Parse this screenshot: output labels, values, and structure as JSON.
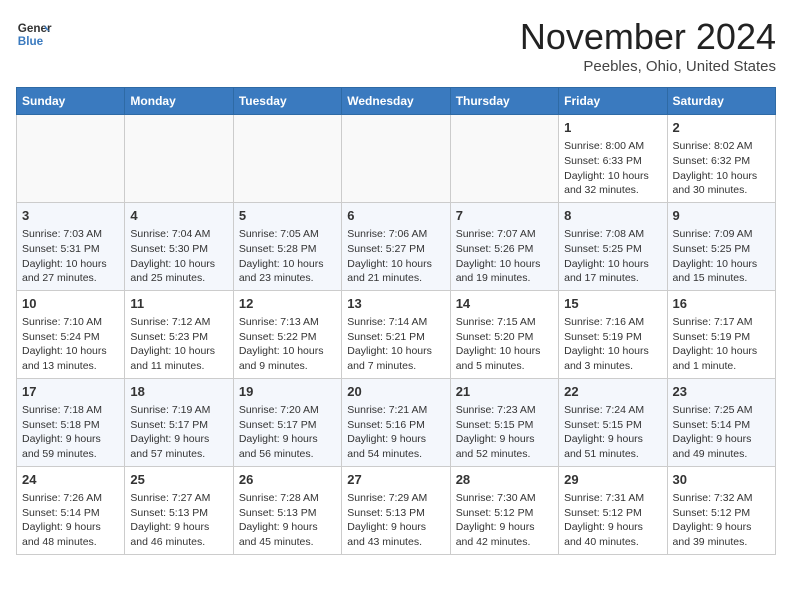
{
  "header": {
    "logo_line1": "General",
    "logo_line2": "Blue",
    "month": "November 2024",
    "location": "Peebles, Ohio, United States"
  },
  "weekdays": [
    "Sunday",
    "Monday",
    "Tuesday",
    "Wednesday",
    "Thursday",
    "Friday",
    "Saturday"
  ],
  "weeks": [
    [
      {
        "day": "",
        "info": ""
      },
      {
        "day": "",
        "info": ""
      },
      {
        "day": "",
        "info": ""
      },
      {
        "day": "",
        "info": ""
      },
      {
        "day": "",
        "info": ""
      },
      {
        "day": "1",
        "info": "Sunrise: 8:00 AM\nSunset: 6:33 PM\nDaylight: 10 hours\nand 32 minutes."
      },
      {
        "day": "2",
        "info": "Sunrise: 8:02 AM\nSunset: 6:32 PM\nDaylight: 10 hours\nand 30 minutes."
      }
    ],
    [
      {
        "day": "3",
        "info": "Sunrise: 7:03 AM\nSunset: 5:31 PM\nDaylight: 10 hours\nand 27 minutes."
      },
      {
        "day": "4",
        "info": "Sunrise: 7:04 AM\nSunset: 5:30 PM\nDaylight: 10 hours\nand 25 minutes."
      },
      {
        "day": "5",
        "info": "Sunrise: 7:05 AM\nSunset: 5:28 PM\nDaylight: 10 hours\nand 23 minutes."
      },
      {
        "day": "6",
        "info": "Sunrise: 7:06 AM\nSunset: 5:27 PM\nDaylight: 10 hours\nand 21 minutes."
      },
      {
        "day": "7",
        "info": "Sunrise: 7:07 AM\nSunset: 5:26 PM\nDaylight: 10 hours\nand 19 minutes."
      },
      {
        "day": "8",
        "info": "Sunrise: 7:08 AM\nSunset: 5:25 PM\nDaylight: 10 hours\nand 17 minutes."
      },
      {
        "day": "9",
        "info": "Sunrise: 7:09 AM\nSunset: 5:25 PM\nDaylight: 10 hours\nand 15 minutes."
      }
    ],
    [
      {
        "day": "10",
        "info": "Sunrise: 7:10 AM\nSunset: 5:24 PM\nDaylight: 10 hours\nand 13 minutes."
      },
      {
        "day": "11",
        "info": "Sunrise: 7:12 AM\nSunset: 5:23 PM\nDaylight: 10 hours\nand 11 minutes."
      },
      {
        "day": "12",
        "info": "Sunrise: 7:13 AM\nSunset: 5:22 PM\nDaylight: 10 hours\nand 9 minutes."
      },
      {
        "day": "13",
        "info": "Sunrise: 7:14 AM\nSunset: 5:21 PM\nDaylight: 10 hours\nand 7 minutes."
      },
      {
        "day": "14",
        "info": "Sunrise: 7:15 AM\nSunset: 5:20 PM\nDaylight: 10 hours\nand 5 minutes."
      },
      {
        "day": "15",
        "info": "Sunrise: 7:16 AM\nSunset: 5:19 PM\nDaylight: 10 hours\nand 3 minutes."
      },
      {
        "day": "16",
        "info": "Sunrise: 7:17 AM\nSunset: 5:19 PM\nDaylight: 10 hours\nand 1 minute."
      }
    ],
    [
      {
        "day": "17",
        "info": "Sunrise: 7:18 AM\nSunset: 5:18 PM\nDaylight: 9 hours\nand 59 minutes."
      },
      {
        "day": "18",
        "info": "Sunrise: 7:19 AM\nSunset: 5:17 PM\nDaylight: 9 hours\nand 57 minutes."
      },
      {
        "day": "19",
        "info": "Sunrise: 7:20 AM\nSunset: 5:17 PM\nDaylight: 9 hours\nand 56 minutes."
      },
      {
        "day": "20",
        "info": "Sunrise: 7:21 AM\nSunset: 5:16 PM\nDaylight: 9 hours\nand 54 minutes."
      },
      {
        "day": "21",
        "info": "Sunrise: 7:23 AM\nSunset: 5:15 PM\nDaylight: 9 hours\nand 52 minutes."
      },
      {
        "day": "22",
        "info": "Sunrise: 7:24 AM\nSunset: 5:15 PM\nDaylight: 9 hours\nand 51 minutes."
      },
      {
        "day": "23",
        "info": "Sunrise: 7:25 AM\nSunset: 5:14 PM\nDaylight: 9 hours\nand 49 minutes."
      }
    ],
    [
      {
        "day": "24",
        "info": "Sunrise: 7:26 AM\nSunset: 5:14 PM\nDaylight: 9 hours\nand 48 minutes."
      },
      {
        "day": "25",
        "info": "Sunrise: 7:27 AM\nSunset: 5:13 PM\nDaylight: 9 hours\nand 46 minutes."
      },
      {
        "day": "26",
        "info": "Sunrise: 7:28 AM\nSunset: 5:13 PM\nDaylight: 9 hours\nand 45 minutes."
      },
      {
        "day": "27",
        "info": "Sunrise: 7:29 AM\nSunset: 5:13 PM\nDaylight: 9 hours\nand 43 minutes."
      },
      {
        "day": "28",
        "info": "Sunrise: 7:30 AM\nSunset: 5:12 PM\nDaylight: 9 hours\nand 42 minutes."
      },
      {
        "day": "29",
        "info": "Sunrise: 7:31 AM\nSunset: 5:12 PM\nDaylight: 9 hours\nand 40 minutes."
      },
      {
        "day": "30",
        "info": "Sunrise: 7:32 AM\nSunset: 5:12 PM\nDaylight: 9 hours\nand 39 minutes."
      }
    ]
  ]
}
